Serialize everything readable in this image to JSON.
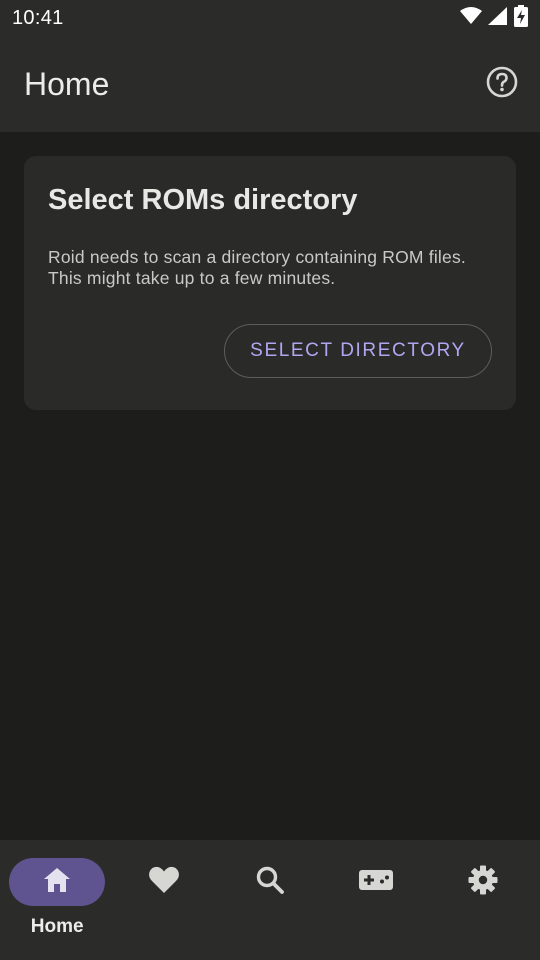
{
  "status_bar": {
    "time": "10:41",
    "icons": [
      "wifi-icon",
      "signal-icon",
      "battery-charging-icon"
    ]
  },
  "top_bar": {
    "title": "Home",
    "help_icon": "help-circle-icon"
  },
  "card": {
    "title": "Select ROMs directory",
    "body": "Roid needs to scan a directory containing ROM files. This might take up to a few minutes.",
    "button_label": "SELECT DIRECTORY"
  },
  "bottom_nav": {
    "items": [
      {
        "icon": "home-icon",
        "label": "Home",
        "active": true
      },
      {
        "icon": "heart-icon",
        "label": "",
        "active": false
      },
      {
        "icon": "search-icon",
        "label": "",
        "active": false
      },
      {
        "icon": "gamepad-icon",
        "label": "",
        "active": false
      },
      {
        "icon": "gear-icon",
        "label": "",
        "active": false
      }
    ]
  },
  "colors": {
    "background": "#1d1e1c",
    "surface": "#2b2c2a",
    "card": "#2a2b29",
    "accent": "#b3a5f2",
    "active_pill": "#5f5490",
    "icon": "#d6d7d3"
  }
}
